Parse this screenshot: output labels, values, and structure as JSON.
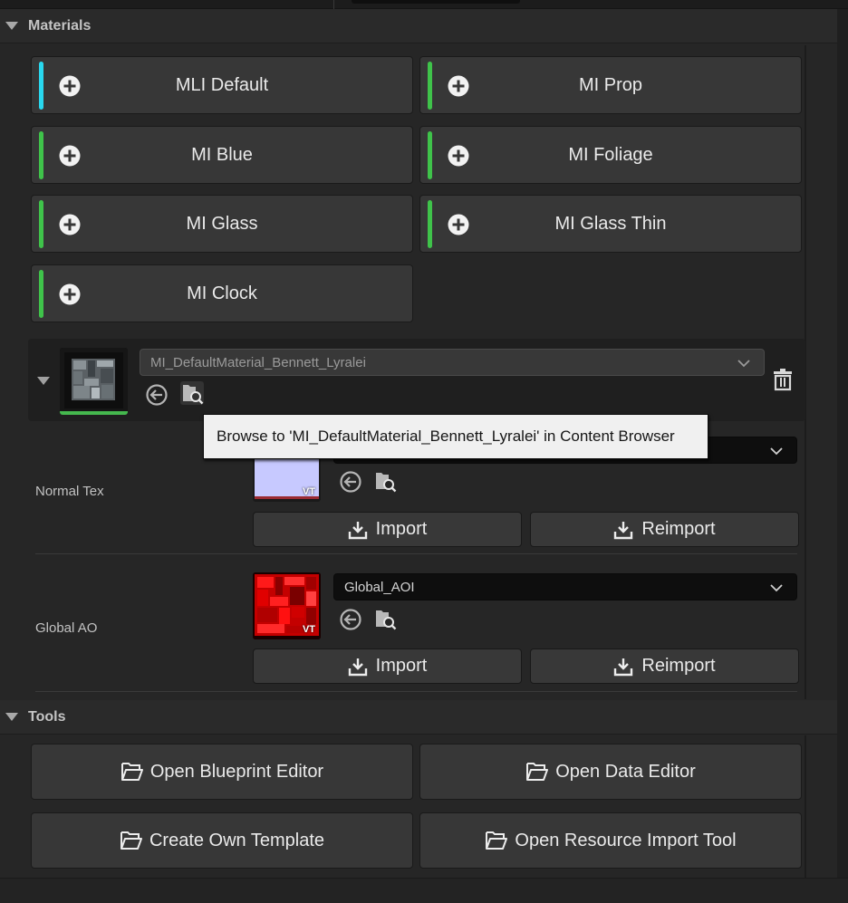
{
  "materials_section": {
    "title": "Materials",
    "buttons": [
      {
        "label": "MLI Default",
        "stripe_color": "#29d8ef"
      },
      {
        "label": "MI Prop",
        "stripe_color": "#3fc34a"
      },
      {
        "label": "MI Blue",
        "stripe_color": "#3fc34a"
      },
      {
        "label": "MI Foliage",
        "stripe_color": "#3fc34a"
      },
      {
        "label": "MI Glass",
        "stripe_color": "#3fc34a"
      },
      {
        "label": "MI Glass Thin",
        "stripe_color": "#3fc34a"
      },
      {
        "label": "MI Clock",
        "stripe_color": "#3fc34a"
      }
    ],
    "plus_icon": "plus-circle-icon"
  },
  "selected_material": {
    "value": "MI_DefaultMaterial_Bennett_Lyralei",
    "use_selected_icon": "use-selected-arrow-icon",
    "browse_icon": "browse-folder-icon",
    "delete_icon": "trash-icon"
  },
  "tooltip": {
    "text": "Browse to 'MI_DefaultMaterial_Bennett_Lyralei' in Content Browser"
  },
  "properties": [
    {
      "label": "Normal Tex",
      "value": "",
      "thumb_badge": "VT",
      "import_label": "Import",
      "reimport_label": "Reimport"
    },
    {
      "label": "Global AO",
      "value": "Global_AOI",
      "thumb_badge": "VT",
      "import_label": "Import",
      "reimport_label": "Reimport"
    }
  ],
  "tools_section": {
    "title": "Tools",
    "buttons": [
      {
        "label": "Open Blueprint Editor"
      },
      {
        "label": "Open Data Editor"
      },
      {
        "label": "Create Own Template"
      },
      {
        "label": "Open Resource Import Tool"
      }
    ],
    "folder_icon": "folder-open-icon"
  },
  "colors": {
    "panel_bg": "#262626",
    "button_bg": "#373737",
    "accent_cyan": "#29d8ef",
    "accent_green": "#3fc34a",
    "tooltip_bg": "#f0f0f0"
  }
}
